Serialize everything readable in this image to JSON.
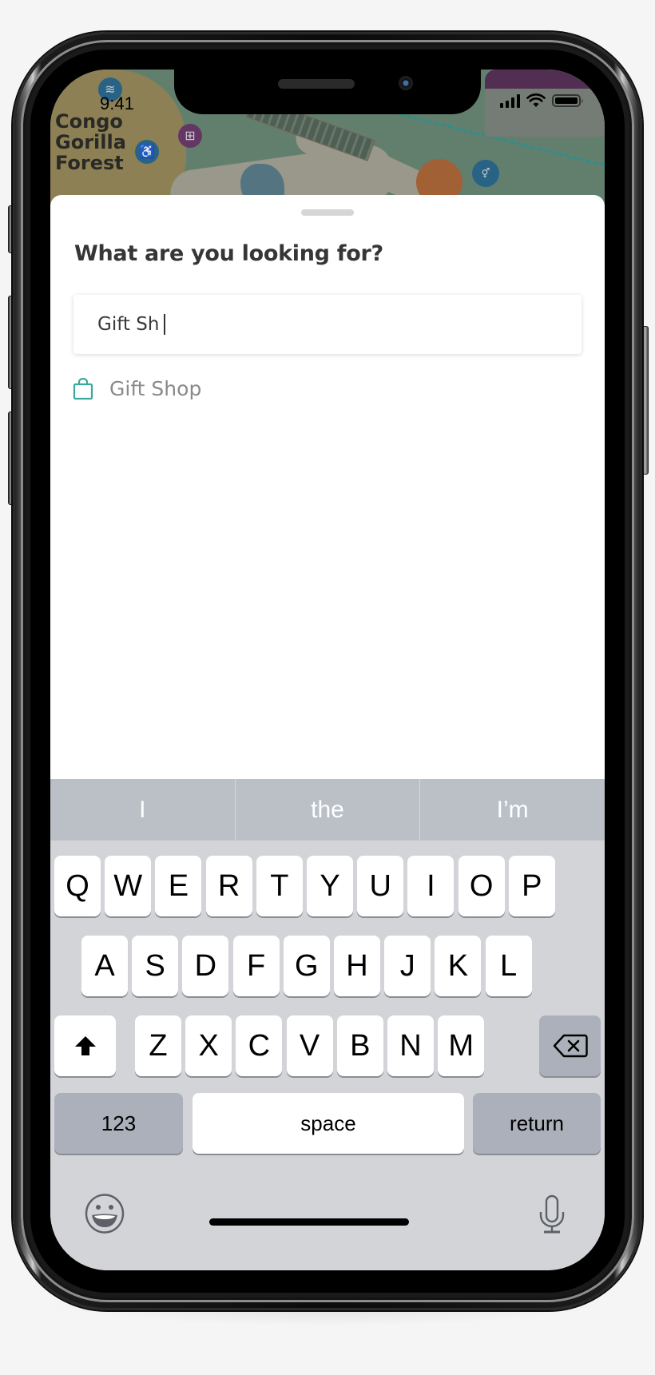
{
  "status_bar": {
    "time": "9:41",
    "icons": [
      "cellular-signal-icon",
      "wifi-icon",
      "battery-icon"
    ]
  },
  "map": {
    "area_label_lines": [
      "Congo",
      "Gorilla",
      "Forest"
    ],
    "poi_icons": [
      "playground-icon",
      "accessibility-icon",
      "gift-icon",
      "restaurant-icon",
      "restroom-icon"
    ],
    "colors": {
      "purple_banner": "#5a345a",
      "teal_path": "#2f9c9a"
    }
  },
  "sheet": {
    "title": "What are you looking for?",
    "search": {
      "value": "Gift Sh",
      "placeholder": ""
    },
    "suggestions": [
      {
        "icon": "shopping-bag-icon",
        "label": "Gift Shop"
      }
    ],
    "accent_color": "#3aa99b"
  },
  "keyboard": {
    "predictions": [
      "I",
      "the",
      "I’m"
    ],
    "rows": [
      [
        "Q",
        "W",
        "E",
        "R",
        "T",
        "Y",
        "U",
        "I",
        "O",
        "P"
      ],
      [
        "A",
        "S",
        "D",
        "F",
        "G",
        "H",
        "J",
        "K",
        "L"
      ],
      [
        "Z",
        "X",
        "C",
        "V",
        "B",
        "N",
        "M"
      ]
    ],
    "shift_icon": "shift-icon",
    "delete_icon": "delete-icon",
    "numbers_label": "123",
    "space_label": "space",
    "return_label": "return",
    "emoji_icon": "emoji-icon",
    "dictation_icon": "microphone-icon"
  }
}
